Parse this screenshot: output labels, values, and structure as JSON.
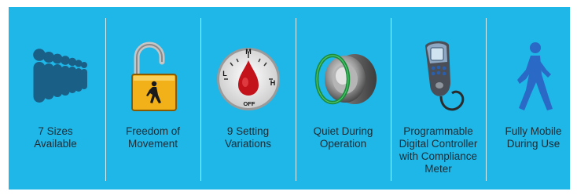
{
  "colors": {
    "panel_background": "#1fb6e8",
    "divider": "#e7f7fd",
    "text": "#1b2c34",
    "icon_blue": "#1a5f86",
    "lock_yellow": "#f2b019",
    "walker_blue": "#2a69c5"
  },
  "features": [
    {
      "label": "7 Sizes\nAvailable",
      "icon": "people-sizes-icon"
    },
    {
      "label": "Freedom of\nMovement",
      "icon": "open-padlock-walker-icon"
    },
    {
      "label": "9 Setting\nVariations",
      "icon": "setting-dial-icon"
    },
    {
      "label": "Quiet During\nOperation",
      "icon": "quiet-button-icon"
    },
    {
      "label": "Programmable\nDigital Controller\nwith Compliance\nMeter",
      "icon": "digital-controller-icon"
    },
    {
      "label": "Fully Mobile\nDuring Use",
      "icon": "walking-person-icon"
    }
  ],
  "dial": {
    "top_letter": "M",
    "left_letter": "L",
    "right_letter": "H",
    "bottom_label": "OFF"
  }
}
